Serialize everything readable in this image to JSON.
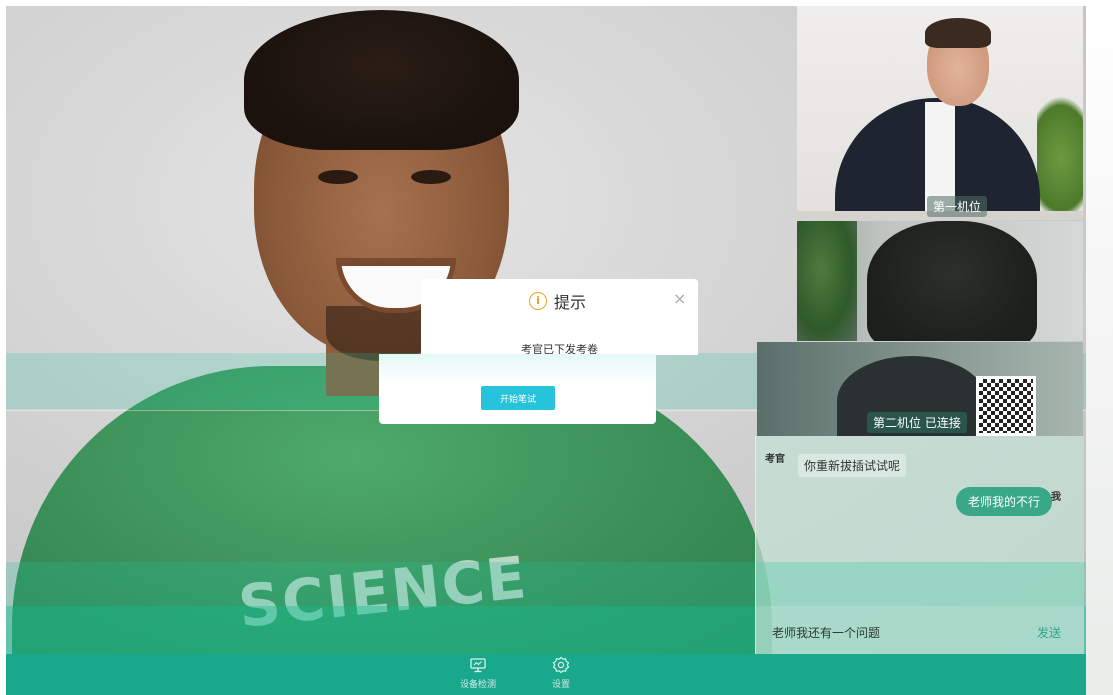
{
  "dialog": {
    "title": "提示",
    "message": "考官已下发考卷",
    "start_button_label": "开始笔试",
    "close_glyph": "×",
    "icon": "info-icon"
  },
  "cameras": {
    "first_label": "第一机位",
    "second_label": "第二机位 已连接"
  },
  "chat": {
    "messages": [
      {
        "sender": "考官",
        "text": "你重新拔插试试呢"
      },
      {
        "sender": "我",
        "text": "老师我的不行"
      }
    ],
    "input_value": "老师我还有一个问题",
    "send_label": "发送"
  },
  "main_video": {
    "shirt_print": "SCIENCE"
  },
  "toolbar": {
    "items": [
      {
        "label": "设备检测",
        "icon": "monitor-icon"
      },
      {
        "label": "设置",
        "icon": "gear-icon"
      }
    ]
  },
  "colors": {
    "accent": "#1aa88d",
    "button": "#26c4dc",
    "info": "#f0a020",
    "chat_bubble": "#3aa888"
  }
}
